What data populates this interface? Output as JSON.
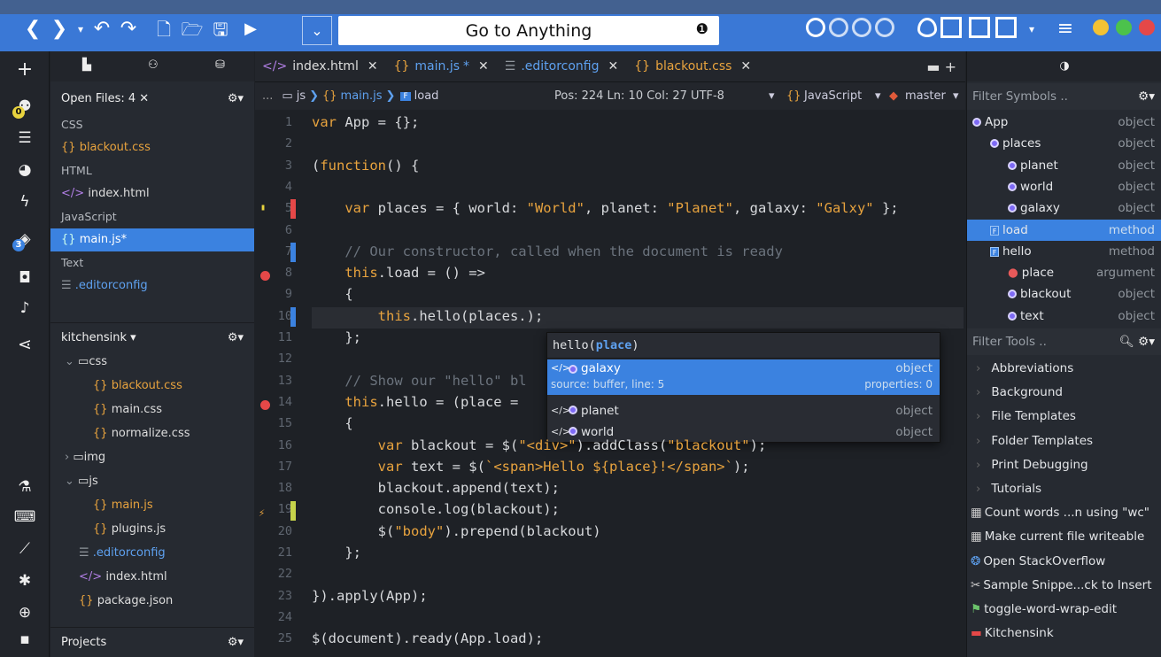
{
  "toolbar": {
    "goto_label": "Go to Anything",
    "goto_dot": "❶"
  },
  "left_icons": {
    "badge1": "0",
    "badge2": "3"
  },
  "files": {
    "open_files_label": "Open Files: 4 ✕",
    "sections": [
      {
        "label": "CSS"
      },
      {
        "label": "HTML"
      },
      {
        "label": "JavaScript"
      },
      {
        "label": "Text"
      }
    ],
    "open": [
      {
        "label": "blackout.css"
      },
      {
        "label": "index.html"
      },
      {
        "label": "main.js*"
      },
      {
        "label": ".editorconfig"
      }
    ],
    "project_label": "kitchensink ▾",
    "tree": [
      {
        "label": "css"
      },
      {
        "label": "blackout.css"
      },
      {
        "label": "main.css"
      },
      {
        "label": "normalize.css"
      },
      {
        "label": "img"
      },
      {
        "label": "js"
      },
      {
        "label": "main.js"
      },
      {
        "label": "plugins.js"
      },
      {
        "label": ".editorconfig"
      },
      {
        "label": "index.html"
      },
      {
        "label": "package.json"
      }
    ],
    "projects_label": "Projects"
  },
  "tabs": [
    {
      "label": "index.html"
    },
    {
      "label": "main.js"
    },
    {
      "label": ".editorconfig"
    },
    {
      "label": "blackout.css"
    }
  ],
  "breadcrumb": {
    "ellipsis": "...",
    "folder": "js",
    "file": "main.js",
    "symbol": "load",
    "position": "Pos: 224  Ln: 10 Col: 27  UTF-8",
    "language": "JavaScript",
    "branch": "master"
  },
  "editor": {
    "line_numbers": [
      "1",
      "2",
      "3",
      "4",
      "5",
      "6",
      "7",
      "8",
      "9",
      "10",
      "11",
      "12",
      "13",
      "14",
      "15",
      "16",
      "17",
      "18",
      "19",
      "20",
      "21",
      "22",
      "23",
      "24",
      "25"
    ],
    "lines": [
      "var App = {};",
      "",
      "(function() {",
      "",
      "    var places = { world: \"World\", planet: \"Planet\", galaxy: \"Galxy\" };",
      "",
      "    // Our constructor, called when the document is ready",
      "    this.load = () =>",
      "    {",
      "        this.hello(places.);",
      "    };",
      "",
      "    // Show our \"hello\" bl",
      "    this.hello = (place = ",
      "    {",
      "        var blackout = $(\"<div>\").addClass(\"blackout\");",
      "        var text = $(`<span>Hello ${place}!</span>`);",
      "        blackout.append(text);",
      "        console.log(blackout);",
      "        $(\"body\").prepend(blackout)",
      "    };",
      "",
      "}).apply(App);",
      "",
      "$(document).ready(App.load);"
    ]
  },
  "autocomplete": {
    "signature": "hello(",
    "signature_param": "place",
    "signature_close": ")",
    "items": [
      {
        "name": "galaxy",
        "kind": "object",
        "detail": "source: buffer, line: 5",
        "props": "properties: 0"
      },
      {
        "name": "planet",
        "kind": "object"
      },
      {
        "name": "world",
        "kind": "object"
      }
    ]
  },
  "symbols": {
    "filter_placeholder": "Filter Symbols ..",
    "items": [
      {
        "name": "App",
        "kind": "object"
      },
      {
        "name": "places",
        "kind": "object"
      },
      {
        "name": "planet",
        "kind": "object"
      },
      {
        "name": "world",
        "kind": "object"
      },
      {
        "name": "galaxy",
        "kind": "object"
      },
      {
        "name": "load",
        "kind": "method"
      },
      {
        "name": "hello",
        "kind": "method"
      },
      {
        "name": "place",
        "kind": "argument"
      },
      {
        "name": "blackout",
        "kind": "object"
      },
      {
        "name": "text",
        "kind": "object"
      }
    ]
  },
  "tools": {
    "filter_placeholder": "Filter Tools ..",
    "items": [
      {
        "label": "Abbreviations"
      },
      {
        "label": "Background"
      },
      {
        "label": "File Templates"
      },
      {
        "label": "Folder Templates"
      },
      {
        "label": "Print Debugging"
      },
      {
        "label": "Tutorials"
      },
      {
        "label": "Count words ...n using \"wc\""
      },
      {
        "label": "Make current file writeable"
      },
      {
        "label": "Open StackOverflow"
      },
      {
        "label": "Sample Snippe...ck to Insert"
      },
      {
        "label": "toggle-word-wrap-edit"
      },
      {
        "label": "Kitchensink"
      }
    ]
  },
  "colors": {
    "accent": "#3b82e0",
    "toolbar": "#3a78d6",
    "keyword": "#e8a33e"
  }
}
